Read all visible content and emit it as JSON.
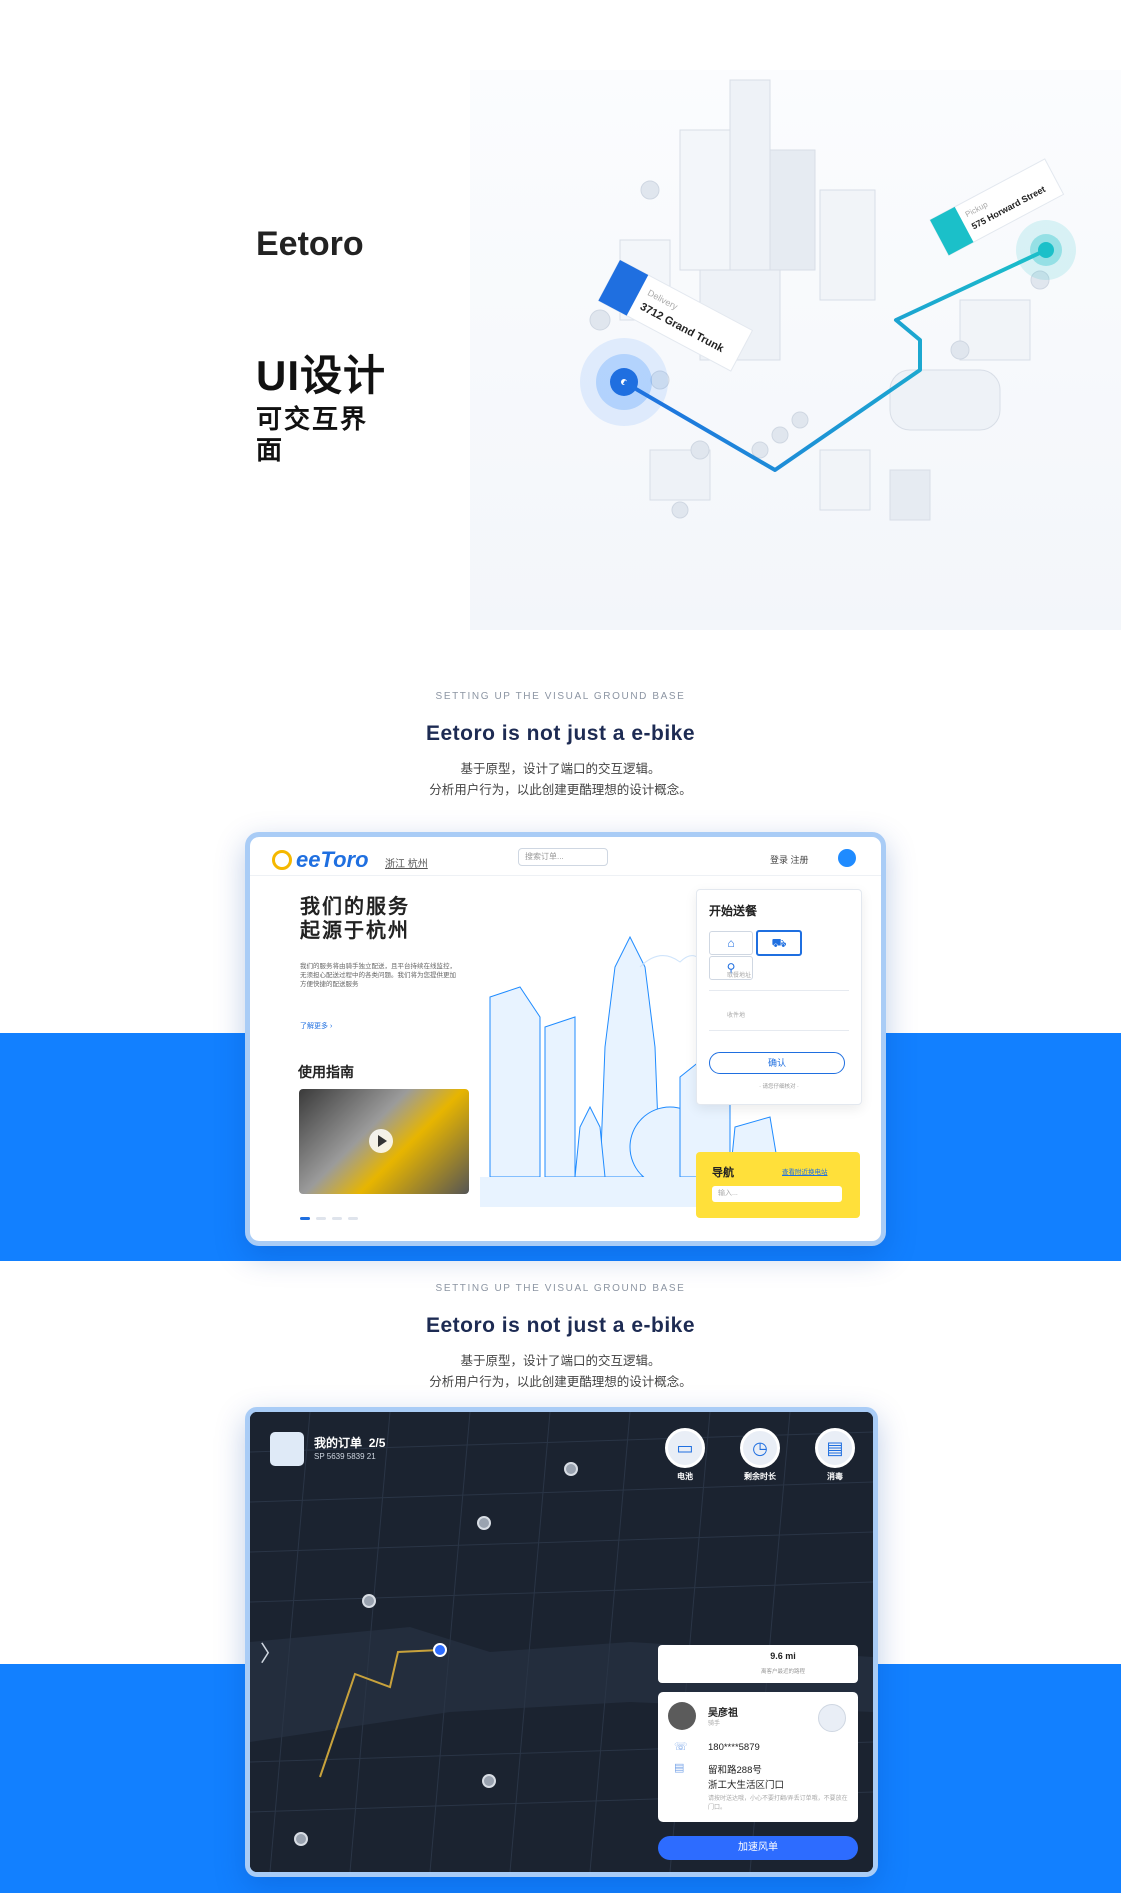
{
  "hero": {
    "brand": "Eetoro",
    "title": "UI设计",
    "subtitle": "可交互界面"
  },
  "section1": {
    "kicker": "SETTING UP THE VISUAL GROUND BASE",
    "headline": "Eetoro is not just a e-bike",
    "desc_line1": "基于原型，设计了端口的交互逻辑。",
    "desc_line2": "分析用户行为，以此创建更酷理想的设计概念。"
  },
  "section2": {
    "kicker": "SETTING UP THE VISUAL GROUND BASE",
    "headline": "Eetoro is not just a e-bike",
    "desc_line1": "基于原型，设计了端口的交互逻辑。",
    "desc_line2": "分析用户行为，以此创建更酷理想的设计概念。"
  },
  "web": {
    "logo": "eeToro",
    "location": "浙江 杭州",
    "search_placeholder": "搜索订单...",
    "login": "登录  注册",
    "hero_line1": "我们的服务",
    "hero_line2": "起源于杭州",
    "paragraph": "我们的服务将由骑手独立配送，且平台持续在线监控，无须担心配送过程中的各类问题。我们将为您提供更加方便快捷的配送服务",
    "more": "了解更多 ›",
    "guide": "使用指南",
    "start_title": "开始送餐",
    "addr_label1": "取餐地址",
    "addr_label2": "收件地",
    "confirm": "确认",
    "start_foot": "· 请您仔细核对 ·",
    "nav_title": "导航",
    "nav_link": "查看附近换电站",
    "nav_input": "输入..."
  },
  "app": {
    "order_title": "我的订单",
    "order_count": "2/5",
    "order_number": "SP 5639 5839 21",
    "btn_battery": "电池",
    "btn_time": "剩余时长",
    "btn_disinfect": "消毒",
    "distance": "9.6 mi",
    "distance_sub": "离客户最近的路程",
    "rider_name": "吴彦祖",
    "rider_role": "骑手",
    "phone": "180****5879",
    "addr1": "留和路288号",
    "addr2": "浙工大生活区门口",
    "note": "请按时送达哦，小心不要打翻/弄丢订单哦，不要放在门口。",
    "cta": "加速风单"
  },
  "colors": {
    "accent_blue": "#1280ff",
    "headline_navy": "#1d2b53",
    "nav_yellow": "#ffe03a",
    "map_bg": "#1b2330",
    "cta_blue": "#2d6cff"
  }
}
